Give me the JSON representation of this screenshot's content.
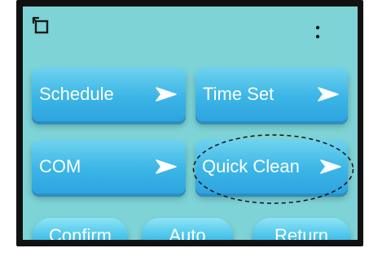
{
  "header": {
    "back_icon": "back-window-icon",
    "menu_icon": "vertical-dots-icon"
  },
  "menu": {
    "schedule": "Schedule",
    "time_set": "Time Set",
    "com": "COM",
    "quick_clean": "Quick Clean",
    "arrow_icon": "arrow-right-icon"
  },
  "footer": {
    "confirm": "Confirm",
    "auto": "Auto",
    "return": "Return"
  },
  "colors": {
    "screen_background": "#7dd3d6",
    "button_blue": "#3bb5e7",
    "text": "#ffffff",
    "frame": "#111111",
    "highlight_outline": "#111111"
  }
}
